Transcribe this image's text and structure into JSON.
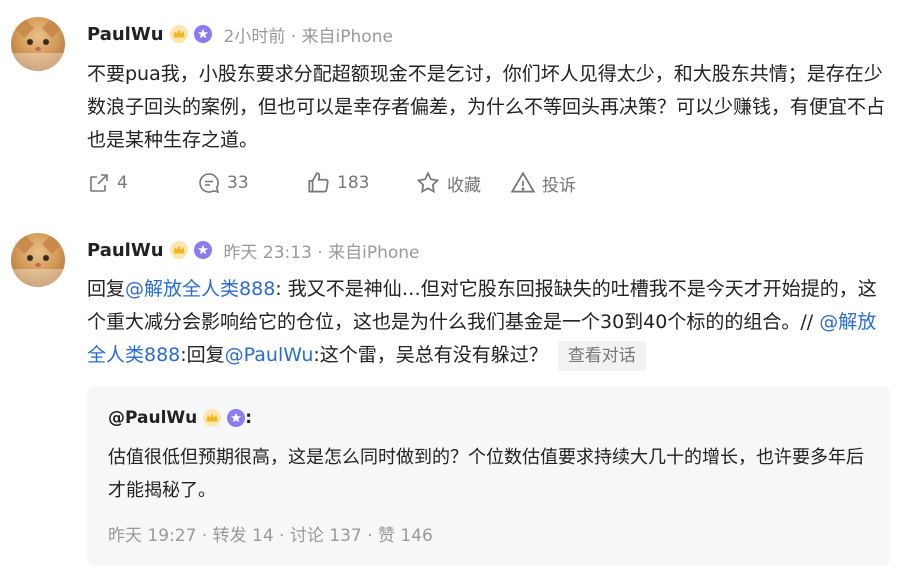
{
  "post1": {
    "author": "PaulWu",
    "meta": "2小时前 · 来自iPhone",
    "text": "不要pua我，小股东要求分配超额现金不是乞讨，你们坏人见得太少，和大股东共情；是存在少数浪子回头的案例，但也可以是幸存者偏差，为什么不等回头再决策？可以少赚钱，有便宜不占也是某种生存之道。",
    "actions": {
      "share_count": "4",
      "comment_count": "33",
      "like_count": "183",
      "favorite_label": "收藏",
      "report_label": "投诉"
    }
  },
  "post2": {
    "author": "PaulWu",
    "meta": "昨天 23:13 · 来自iPhone",
    "reply_prefix": "回复",
    "reply_to": "@解放全人类888",
    "body_part1": ": 我又不是神仙…但对它股东回报缺失的吐槽我不是今天才开始提的，这个重大减分会影响给它的仓位，这也是为什么我们基金是一个30到40个标的的组合。//",
    "mention2": "@解放全人类888",
    "body_part2": ":回复",
    "mention3": "@PaulWu",
    "body_part3": ":这个雷，吴总有没有躲过？",
    "view_conversation": "查看对话"
  },
  "quote": {
    "author": "@PaulWu",
    "colon": ":",
    "text": "估值很低但预期很高，这是怎么同时做到的？个位数估值要求持续大几十的增长，也许要多年后才能揭秘了。",
    "footer": "昨天 19:27 · 转发 14 · 讨论 137 · 赞 146"
  },
  "colors": {
    "link": "#2a6bd6",
    "muted": "#999999",
    "badge_gold": "#f5b623",
    "badge_purple": "#8b7cf0"
  }
}
